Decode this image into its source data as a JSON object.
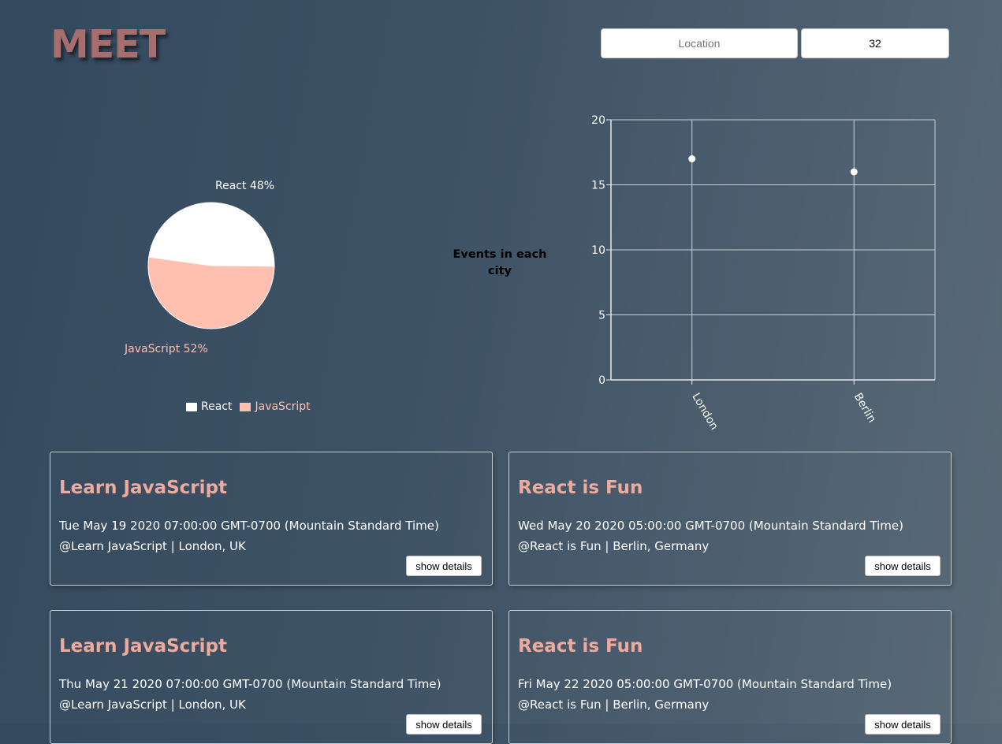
{
  "app": {
    "title": "MEET"
  },
  "search": {
    "city_placeholder": "Location",
    "city_value": "",
    "number_of_events_value": "32"
  },
  "chart_data": [
    {
      "type": "pie",
      "categories": [
        "React",
        "JavaScript"
      ],
      "values": [
        48,
        52
      ],
      "slice_labels": [
        "React 48%",
        "JavaScript 52%"
      ],
      "colors": [
        "#ffffff",
        "#ffc0b0"
      ],
      "legend": [
        "React",
        "JavaScript"
      ],
      "legend_placement": "bottom"
    },
    {
      "type": "scatter",
      "title": "Events in each city",
      "categories": [
        "London",
        "Berlin"
      ],
      "values": [
        17,
        16
      ],
      "ylim": [
        0,
        20
      ],
      "yticks": [
        0,
        5,
        10,
        15,
        20
      ],
      "grid": true
    }
  ],
  "events": [
    {
      "title": "Learn JavaScript",
      "time": "Tue May 19 2020 07:00:00 GMT-0700 (Mountain Standard Time)",
      "location": "@Learn JavaScript | London, UK",
      "button_label": "show details"
    },
    {
      "title": "React is Fun",
      "time": "Wed May 20 2020 05:00:00 GMT-0700 (Mountain Standard Time)",
      "location": "@React is Fun | Berlin, Germany",
      "button_label": "show details"
    },
    {
      "title": "Learn JavaScript",
      "time": "Thu May 21 2020 07:00:00 GMT-0700 (Mountain Standard Time)",
      "location": "@Learn JavaScript | London, UK",
      "button_label": "show details"
    },
    {
      "title": "React is Fun",
      "time": "Fri May 22 2020 05:00:00 GMT-0700 (Mountain Standard Time)",
      "location": "@React is Fun | Berlin, Germany",
      "button_label": "show details"
    }
  ]
}
